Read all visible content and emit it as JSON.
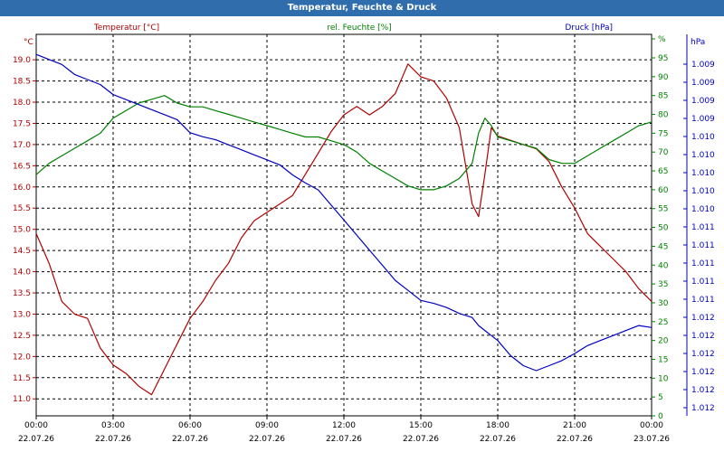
{
  "window": {
    "title": "Temperatur, Feuchte & Druck"
  },
  "chart_data": {
    "type": "line",
    "title": "Temperatur, Feuchte & Druck",
    "grid": true,
    "axes": {
      "left": {
        "unit": "°C",
        "label": "Temperatur [°C]",
        "color": "#b00000",
        "ticks": [
          "11.0",
          "11.5",
          "12.0",
          "12.5",
          "13.0",
          "13.5",
          "14.0",
          "14.5",
          "15.0",
          "15.5",
          "16.0",
          "16.5",
          "17.0",
          "17.5",
          "18.0",
          "18.5",
          "19.0"
        ],
        "range": [
          10.6,
          19.6
        ]
      },
      "mid": {
        "unit": "%",
        "label": "rel. Feuchte [%]",
        "color": "#008000",
        "ticks": [
          "0",
          "5",
          "10",
          "15",
          "20",
          "25",
          "30",
          "35",
          "40",
          "45",
          "50",
          "55",
          "60",
          "65",
          "70",
          "75",
          "80",
          "85",
          "90",
          "95",
          "%"
        ],
        "range": [
          0,
          95
        ]
      },
      "right": {
        "unit": "hPa",
        "label": "Druck [hPa]",
        "color": "#0000c0",
        "ticks": [
          "1.009",
          "1.009",
          "1.009",
          "1.009",
          "1.010",
          "1.010",
          "1.010",
          "1.010",
          "1.010",
          "1.011",
          "1.011",
          "1.011",
          "1.011",
          "1.011",
          "1.012",
          "1.012",
          "1.012",
          "1.012",
          "1.012",
          "1.012"
        ],
        "range": [
          1008.8,
          1012.6
        ]
      }
    },
    "x_ticks": [
      {
        "time": "00:00",
        "date": "22.07.26"
      },
      {
        "time": "03:00",
        "date": "22.07.26"
      },
      {
        "time": "06:00",
        "date": "22.07.26"
      },
      {
        "time": "09:00",
        "date": "22.07.26"
      },
      {
        "time": "12:00",
        "date": "22.07.26"
      },
      {
        "time": "15:00",
        "date": "22.07.26"
      },
      {
        "time": "18:00",
        "date": "22.07.26"
      },
      {
        "time": "21:00",
        "date": "22.07.26"
      },
      {
        "time": "00:00",
        "date": "23.07.26"
      }
    ],
    "x_unit": "hours",
    "series": [
      {
        "name": "Temperatur [°C]",
        "axis": "left",
        "color": "#b00000",
        "x": [
          0,
          0.5,
          1,
          1.5,
          2,
          2.5,
          3,
          3.5,
          4,
          4.5,
          5,
          5.5,
          6,
          6.5,
          7,
          7.5,
          8,
          8.5,
          9,
          9.5,
          10,
          10.5,
          11,
          11.5,
          12,
          12.5,
          13,
          13.5,
          14,
          14.5,
          15,
          15.5,
          16,
          16.5,
          17,
          17.25,
          17.5,
          17.75,
          18,
          18.5,
          19,
          19.5,
          20,
          20.5,
          21,
          21.5,
          22,
          22.5,
          23,
          23.5,
          24
        ],
        "values": [
          14.9,
          14.2,
          13.3,
          13.0,
          12.9,
          12.2,
          11.8,
          11.6,
          11.3,
          11.1,
          11.7,
          12.3,
          12.9,
          13.3,
          13.8,
          14.2,
          14.8,
          15.2,
          15.4,
          15.6,
          15.8,
          16.3,
          16.8,
          17.3,
          17.7,
          17.9,
          17.7,
          17.9,
          18.2,
          18.9,
          18.6,
          18.5,
          18.1,
          17.4,
          15.6,
          15.3,
          16.3,
          17.4,
          17.2,
          17.1,
          17.0,
          16.9,
          16.6,
          16.0,
          15.5,
          14.9,
          14.6,
          14.3,
          14.0,
          13.6,
          13.3
        ]
      },
      {
        "name": "rel. Feuchte [%]",
        "axis": "mid",
        "color": "#008000",
        "x": [
          0,
          0.5,
          1,
          1.5,
          2,
          2.5,
          3,
          3.5,
          4,
          4.5,
          5,
          5.5,
          6,
          6.5,
          7,
          7.5,
          8,
          8.5,
          9,
          9.5,
          10,
          10.5,
          11,
          11.5,
          12,
          12.5,
          13,
          13.5,
          14,
          14.5,
          15,
          15.5,
          16,
          16.5,
          17,
          17.25,
          17.5,
          17.75,
          18,
          18.5,
          19,
          19.5,
          20,
          20.5,
          21,
          21.5,
          22,
          22.5,
          23,
          23.5,
          24
        ],
        "values": [
          64,
          67,
          69,
          71,
          73,
          75,
          79,
          81,
          83,
          84,
          85,
          83,
          82,
          82,
          81,
          80,
          79,
          78,
          77,
          76,
          75,
          74,
          74,
          73,
          72,
          70,
          67,
          65,
          63,
          61,
          60,
          60,
          61,
          63,
          67,
          75,
          79,
          77,
          74,
          73,
          72,
          71,
          68,
          67,
          67,
          69,
          71,
          73,
          75,
          77,
          78
        ]
      },
      {
        "name": "Druck [hPa]",
        "axis": "right",
        "color": "#0000c0",
        "x": [
          0,
          0.5,
          1,
          1.5,
          2,
          2.5,
          3,
          3.5,
          4,
          4.5,
          5,
          5.5,
          6,
          6.5,
          7,
          7.5,
          8,
          8.5,
          9,
          9.5,
          10,
          10.5,
          11,
          11.5,
          12,
          12.5,
          13,
          13.5,
          14,
          14.5,
          15,
          15.5,
          16,
          16.5,
          17,
          17.25,
          17.5,
          17.75,
          18,
          18.5,
          19,
          19.5,
          20,
          20.5,
          21,
          21.5,
          22,
          22.5,
          23,
          23.5,
          24
        ],
        "values": [
          1012.4,
          1012.35,
          1012.3,
          1012.2,
          1012.15,
          1012.1,
          1012.0,
          1011.95,
          1011.9,
          1011.85,
          1011.8,
          1011.75,
          1011.62,
          1011.58,
          1011.55,
          1011.5,
          1011.45,
          1011.4,
          1011.35,
          1011.3,
          1011.2,
          1011.12,
          1011.05,
          1010.9,
          1010.75,
          1010.6,
          1010.45,
          1010.3,
          1010.15,
          1010.05,
          1009.95,
          1009.92,
          1009.88,
          1009.82,
          1009.78,
          1009.7,
          1009.65,
          1009.6,
          1009.55,
          1009.4,
          1009.3,
          1009.25,
          1009.3,
          1009.35,
          1009.42,
          1009.5,
          1009.55,
          1009.6,
          1009.65,
          1009.7,
          1009.68
        ]
      }
    ]
  }
}
